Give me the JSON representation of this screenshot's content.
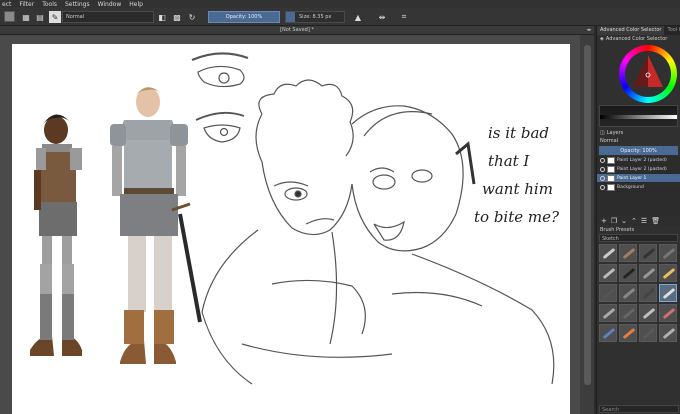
{
  "menu": [
    "ect",
    "Filter",
    "Tools",
    "Settings",
    "Window",
    "Help"
  ],
  "toolbar": {
    "blend_mode": "Normal",
    "opacity": "Opacity: 100%",
    "size": "Size: 8.35 px"
  },
  "document": {
    "tab_title": "[Not Saved]  *"
  },
  "dock": {
    "tabs": [
      "Advanced Color Selector",
      "Tool Op"
    ],
    "color_panel_title": "Advanced Color Selector",
    "layers": {
      "title": "Layers",
      "blend": "Normal",
      "opacity": "Opacity:  100%",
      "items": [
        {
          "name": "Paint Layer 2 (pasted)"
        },
        {
          "name": "Paint Layer 2 (pasted)"
        },
        {
          "name": "Paint Layer 1"
        },
        {
          "name": "Background"
        }
      ]
    },
    "brushes": {
      "title": "Brush Presets",
      "filter": "Sketch",
      "search_placeholder": "Search"
    }
  },
  "drawing": {
    "handwritten_text": [
      "is it bad",
      "that I",
      "want him",
      "to bite me?"
    ]
  },
  "colors": {
    "accent": "#4a6a93",
    "canvas": "#ffffff",
    "panel": "#303030"
  }
}
